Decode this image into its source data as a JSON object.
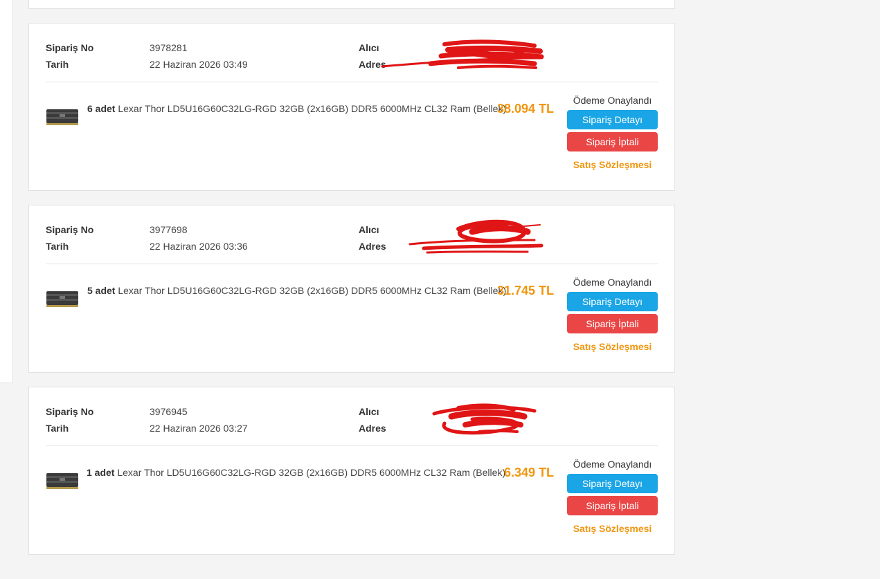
{
  "labels": {
    "order_no": "Sipariş No",
    "date": "Tarih",
    "recipient": "Alıcı",
    "address": "Adres",
    "status": "Ödeme Onaylandı",
    "detail_button": "Sipariş Detayı",
    "cancel_button": "Sipariş İptali",
    "contract_link": "Satış Sözleşmesi"
  },
  "colors": {
    "price": "#f0960f",
    "detail_button": "#1aa5e6",
    "cancel_button": "#ea4646",
    "redaction": "#e01515"
  },
  "orders": [
    {
      "order_no": "3978281",
      "date": "22 Haziran 2026 03:49",
      "quantity": "6 adet",
      "product": "Lexar Thor LD5U16G60C32LG-RGD 32GB (2x16GB) DDR5 6000MHz CL32 Ram (Bellek)",
      "price": "38.094 TL"
    },
    {
      "order_no": "3977698",
      "date": "22 Haziran 2026 03:36",
      "quantity": "5 adet",
      "product": "Lexar Thor LD5U16G60C32LG-RGD 32GB (2x16GB) DDR5 6000MHz CL32 Ram (Bellek)",
      "price": "31.745 TL"
    },
    {
      "order_no": "3976945",
      "date": "22 Haziran 2026 03:27",
      "quantity": "1 adet",
      "product": "Lexar Thor LD5U16G60C32LG-RGD 32GB (2x16GB) DDR5 6000MHz CL32 Ram (Bellek)",
      "price": "6.349 TL"
    }
  ]
}
